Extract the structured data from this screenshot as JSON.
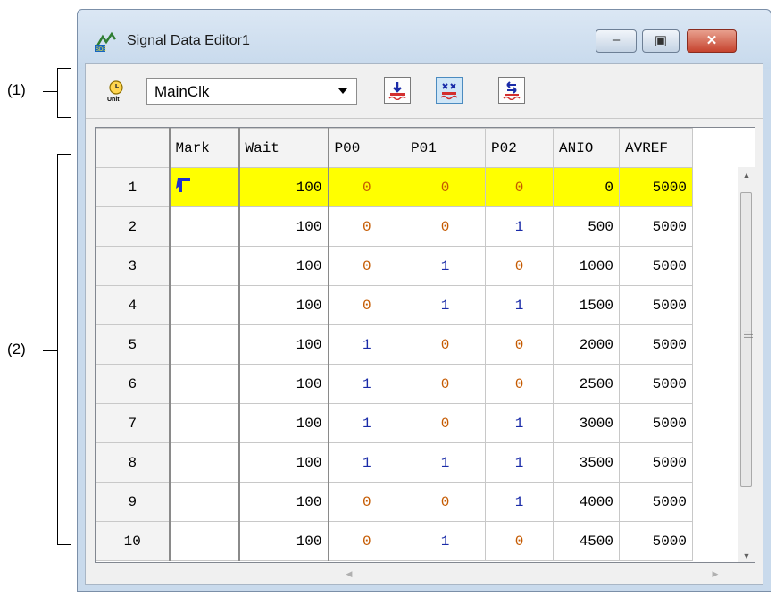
{
  "annotations": {
    "label1": "(1)",
    "label2": "(2)"
  },
  "window": {
    "title": "Signal Data Editor1",
    "minimize_icon": "minimize-icon",
    "maximize_icon": "maximize-icon",
    "close_icon": "close-icon"
  },
  "toolbar": {
    "unit_icon": "clock-unit-icon",
    "unit_select": {
      "value": "MainClk"
    },
    "buttons": [
      "import-icon",
      "export-icon",
      "import-wave-icon"
    ]
  },
  "grid": {
    "columns": [
      "",
      "Mark",
      "Wait",
      "P00",
      "P01",
      "P02",
      "ANIO",
      "AVREF"
    ],
    "rows": [
      {
        "no": "1",
        "wait": "100",
        "p00": "0",
        "p01": "0",
        "p02": "0",
        "anio": "0",
        "avref": "5000",
        "mark": true
      },
      {
        "no": "2",
        "wait": "100",
        "p00": "0",
        "p01": "0",
        "p02": "1",
        "anio": "500",
        "avref": "5000"
      },
      {
        "no": "3",
        "wait": "100",
        "p00": "0",
        "p01": "1",
        "p02": "0",
        "anio": "1000",
        "avref": "5000"
      },
      {
        "no": "4",
        "wait": "100",
        "p00": "0",
        "p01": "1",
        "p02": "1",
        "anio": "1500",
        "avref": "5000"
      },
      {
        "no": "5",
        "wait": "100",
        "p00": "1",
        "p01": "0",
        "p02": "0",
        "anio": "2000",
        "avref": "5000"
      },
      {
        "no": "6",
        "wait": "100",
        "p00": "1",
        "p01": "0",
        "p02": "0",
        "anio": "2500",
        "avref": "5000"
      },
      {
        "no": "7",
        "wait": "100",
        "p00": "1",
        "p01": "0",
        "p02": "1",
        "anio": "3000",
        "avref": "5000"
      },
      {
        "no": "8",
        "wait": "100",
        "p00": "1",
        "p01": "1",
        "p02": "1",
        "anio": "3500",
        "avref": "5000"
      },
      {
        "no": "9",
        "wait": "100",
        "p00": "0",
        "p01": "0",
        "p02": "1",
        "anio": "4000",
        "avref": "5000"
      },
      {
        "no": "10",
        "wait": "100",
        "p00": "0",
        "p01": "1",
        "p02": "0",
        "anio": "4500",
        "avref": "5000"
      }
    ]
  },
  "colors": {
    "highlight": "#ffff00",
    "bit0": "#c55a00",
    "bit1": "#1a2ba8",
    "mark_arrow": "#1f2fd0"
  }
}
